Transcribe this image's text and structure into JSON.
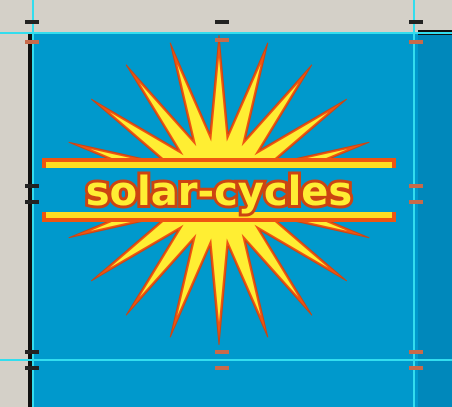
{
  "logo": {
    "text": "solar-cycles",
    "colors": {
      "background": "#0099cc",
      "sun_fill": "#ffee33",
      "sun_outline": "#ee5511",
      "text_fill": "#ffee33",
      "text_outline": "#cc4411",
      "guide": "#33ddee"
    }
  },
  "handles": {
    "icon": "selection-handle-icon"
  }
}
